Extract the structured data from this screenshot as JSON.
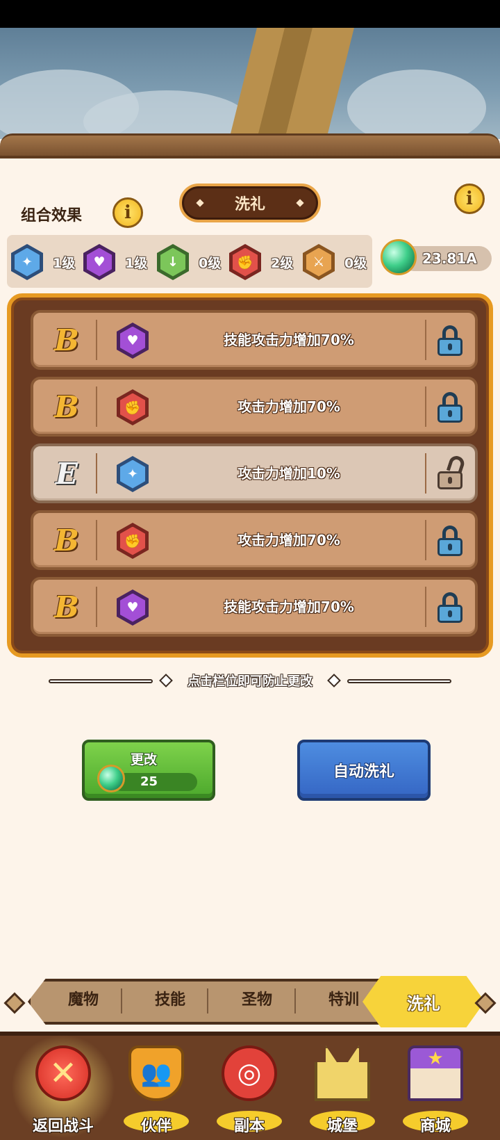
{
  "header": {
    "title": "洗礼"
  },
  "combo": {
    "label": "组合效果",
    "items": [
      {
        "icon": "blue-gem-icon",
        "color": "#5ea9e8",
        "level": "1级"
      },
      {
        "icon": "purple-heart-gem-icon",
        "color": "#a34fd6",
        "level": "1级"
      },
      {
        "icon": "green-sword-gem-icon",
        "color": "#7cc65a",
        "level": "0级"
      },
      {
        "icon": "red-fist-gem-icon",
        "color": "#e2514a",
        "level": "2级"
      },
      {
        "icon": "orange-sword-gem-icon",
        "color": "#e8a451",
        "level": "0级"
      }
    ]
  },
  "currency": {
    "icon": "green-orb-icon",
    "value": "23.81A"
  },
  "slots": [
    {
      "grade": "B",
      "gem": "purple-heart-gem-icon",
      "color": "#a34fd6",
      "text": "技能攻击力增加70%",
      "locked": true
    },
    {
      "grade": "B",
      "gem": "red-fist-gem-icon",
      "color": "#e2514a",
      "text": "攻击力增加70%",
      "locked": true
    },
    {
      "grade": "E",
      "gem": "blue-gem-icon",
      "color": "#5ea9e8",
      "text": "攻击力增加10%",
      "locked": false
    },
    {
      "grade": "B",
      "gem": "red-fist-gem-icon",
      "color": "#e2514a",
      "text": "攻击力增加70%",
      "locked": true
    },
    {
      "grade": "B",
      "gem": "purple-heart-gem-icon",
      "color": "#a34fd6",
      "text": "技能攻击力增加70%",
      "locked": true
    }
  ],
  "hint": "点击栏位即可防止更改",
  "buttons": {
    "change_label": "更改",
    "change_cost": "25",
    "auto_label": "自动洗礼"
  },
  "tabs": {
    "items": [
      "魔物",
      "技能",
      "圣物",
      "特训"
    ],
    "active": "洗礼"
  },
  "nav": {
    "items": [
      {
        "label": "返回战斗",
        "icon": "close-x-icon"
      },
      {
        "label": "伙伴",
        "icon": "partner-shield-icon"
      },
      {
        "label": "副本",
        "icon": "dungeon-target-icon"
      },
      {
        "label": "城堡",
        "icon": "castle-icon"
      },
      {
        "label": "商城",
        "icon": "shop-icon"
      }
    ]
  }
}
